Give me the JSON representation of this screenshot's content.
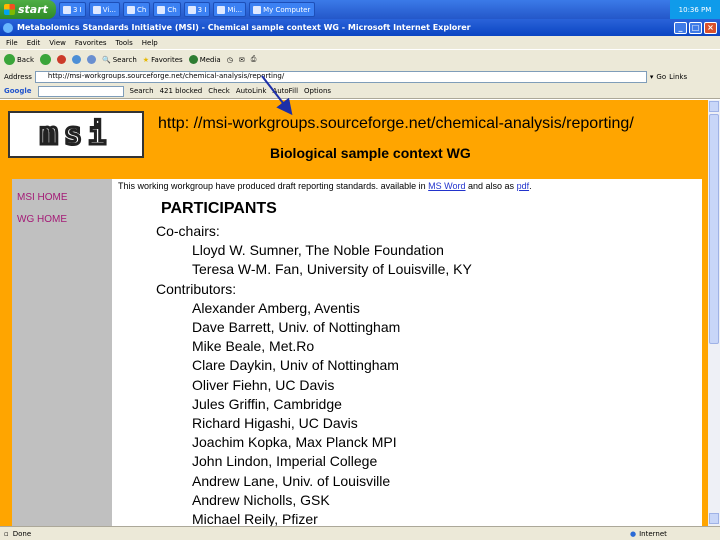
{
  "taskbar": {
    "start_label": "start",
    "tasks": [
      "3 I",
      "Vi...",
      "Ch",
      "Ch",
      "3 I",
      "Mi...",
      "My Computer"
    ],
    "clock": "10:36 PM"
  },
  "window": {
    "title": "Metabolomics Standards Initiative (MSI) - Chemical sample context WG - Microsoft Internet Explorer",
    "min": "_",
    "max": "□",
    "close": "×"
  },
  "menu": [
    "File",
    "Edit",
    "View",
    "Favorites",
    "Tools",
    "Help"
  ],
  "toolbar": {
    "back": "Back",
    "search": "Search",
    "favorites": "Favorites",
    "media": "Media"
  },
  "address": {
    "label": "Address",
    "url": "http://msi-workgroups.sourceforge.net/chemical-analysis/reporting/",
    "go": "Go",
    "links": "Links"
  },
  "googlebar": {
    "label": "Google",
    "search": "Search",
    "blocked": "421 blocked",
    "check": "Check",
    "autolink": "AutoLink",
    "autofill": "AutoFill",
    "options": "Options"
  },
  "page": {
    "logo": "msi",
    "url_annotation": "http: //msi-workgroups.sourceforge.net/chemical-analysis/reporting/",
    "wg_title": "Biological sample context WG",
    "nav": [
      "MSI HOME",
      "WG HOME"
    ],
    "intro_text": "This working workgroup have produced draft reporting standards. available in ",
    "intro_link1": "MS Word",
    "intro_mid": " and also as ",
    "intro_link2": "pdf",
    "intro_end": ".",
    "participants_title": "PARTICIPANTS",
    "cochairs_label": "Co-chairs:",
    "cochairs": [
      "Lloyd W. Sumner, The Noble Foundation",
      "Teresa W-M. Fan, University of Louisville, KY"
    ],
    "contributors_label": "Contributors:",
    "contributors": [
      "Alexander Amberg, Aventis",
      "Dave Barrett, Univ. of Nottingham",
      "Mike Beale, Met.Ro",
      "Clare Daykin, Univ of Nottingham",
      "Oliver Fiehn, UC Davis",
      "Jules Griffin, Cambridge",
      "Richard Higashi, UC Davis",
      "Joachim Kopka, Max Planck MPI",
      "John Lindon, Imperial College",
      "Andrew Lane, Univ.  of Louisville",
      "Andrew Nicholls, GSK",
      "Michael Reily, Pfizer"
    ]
  },
  "status": {
    "text": "Done",
    "zone": "Internet"
  },
  "colors": {
    "orange": "#ffa500",
    "nav_gray": "#c0c0c0",
    "nav_link": "#a41a76",
    "arrow": "#1d2fa8"
  }
}
